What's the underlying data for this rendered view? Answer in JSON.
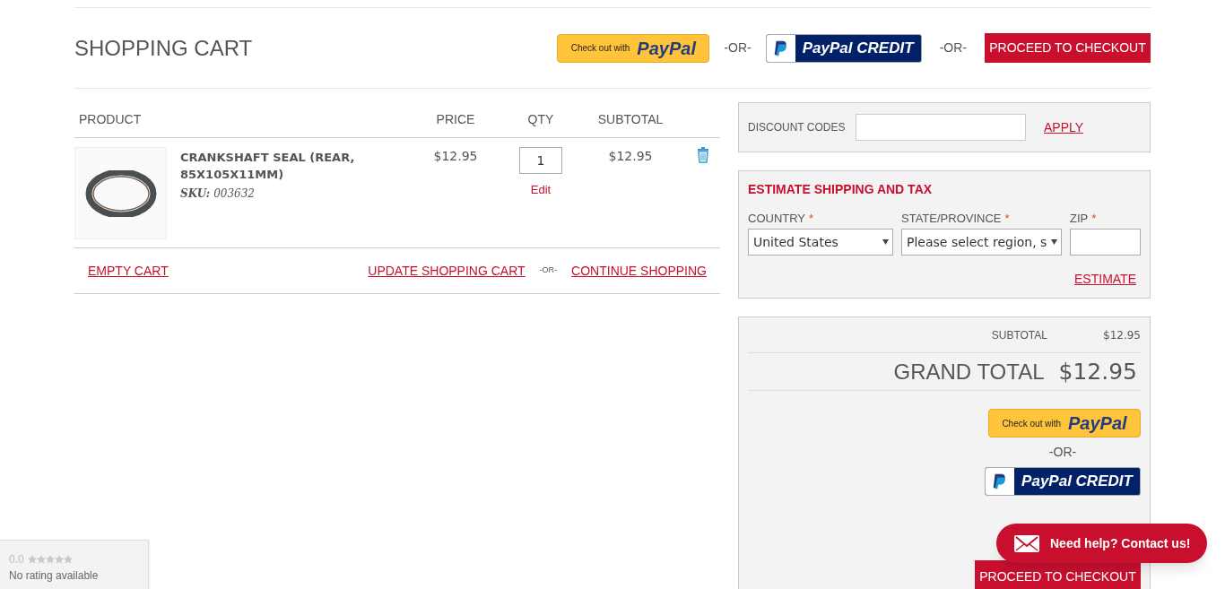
{
  "page_title": "SHOPPING CART",
  "top_actions": {
    "paypal": {
      "prefix": "Check out with",
      "brand": "PayPal"
    },
    "or_1": "-OR-",
    "credit": {
      "label": "PayPal CREDIT"
    },
    "or_2": "-OR-",
    "checkout": "PROCEED TO CHECKOUT"
  },
  "cart_table": {
    "columns": [
      "PRODUCT",
      "PRICE",
      "QTY",
      "SUBTOTAL"
    ],
    "rows": [
      {
        "name": "CRANKSHAFT SEAL (REAR, 85X105X11MM)",
        "sku_label": "SKU:",
        "sku": "003632",
        "price": "$12.95",
        "qty": "1",
        "edit": "Edit",
        "subtotal": "$12.95"
      }
    ]
  },
  "cart_actions": {
    "empty": "EMPTY CART",
    "update": "UPDATE SHOPPING CART",
    "or": "-OR-",
    "continue": "CONTINUE SHOPPING"
  },
  "discount": {
    "label": "DISCOUNT CODES",
    "apply": "APPLY"
  },
  "shipping": {
    "title": "ESTIMATE SHIPPING AND TAX",
    "fields": [
      {
        "label": "COUNTRY",
        "required": "*",
        "kind": "select",
        "value": "United States"
      },
      {
        "label": "STATE/PROVINCE",
        "required": "*",
        "kind": "select",
        "value": "Please select region, s"
      },
      {
        "label": "ZIP",
        "required": "*",
        "kind": "text"
      }
    ],
    "estimate": "ESTIMATE"
  },
  "totals": {
    "subtotal_label": "SUBTOTAL",
    "subtotal": "$12.95",
    "grand_label": "GRAND TOTAL",
    "grand": "$12.95",
    "paypal": {
      "prefix": "Check out with",
      "brand": "PayPal"
    },
    "or": "-OR-",
    "credit": {
      "label": "PayPal CREDIT"
    },
    "checkout": "PROCEED TO CHECKOUT"
  },
  "rating_badge": {
    "score": "0.0",
    "stars": 0,
    "text": "No rating available"
  },
  "help_bubble": {
    "label": "Need help? Contact us!"
  }
}
